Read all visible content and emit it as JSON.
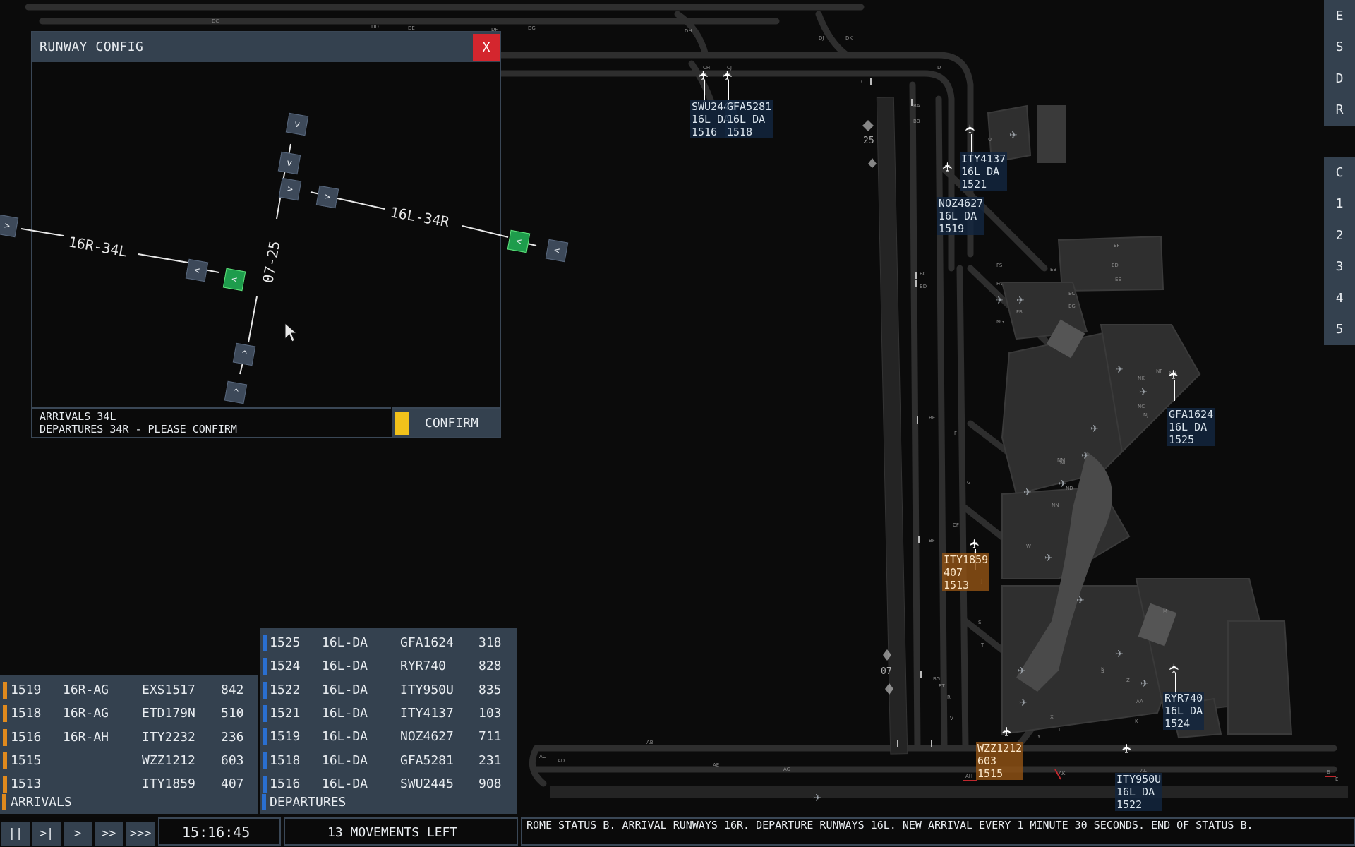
{
  "side_menu_top": [
    "E",
    "S",
    "D",
    "R"
  ],
  "side_menu_bottom": [
    "C",
    "1",
    "2",
    "3",
    "4",
    "5"
  ],
  "runway_config": {
    "title": "RUNWAY CONFIG",
    "close_label": "X",
    "runway_labels": {
      "left": "16R-34L",
      "right": "16L-34R",
      "cross": "07-25"
    },
    "message_line1": "ARRIVALS 34L",
    "message_line2": "DEPARTURES 34R - PLEASE CONFIRM",
    "confirm_label": "CONFIRM",
    "buttons": {
      "down": "v",
      "right": ">",
      "left": "<",
      "up": "^"
    }
  },
  "map_labels": {
    "runway_25": "25",
    "runway_07": "07",
    "taxiways": [
      "DC",
      "DD",
      "DE",
      "DF",
      "DG",
      "DH",
      "DJ",
      "DK",
      "CH",
      "CJ",
      "C",
      "D",
      "BA",
      "BB",
      "U",
      "FS",
      "FA",
      "FB",
      "EB",
      "EC",
      "ED",
      "EE",
      "EF",
      "EG",
      "NG",
      "BC",
      "BD",
      "NF",
      "NK",
      "NH",
      "NC",
      "NJ",
      "NM",
      "NL",
      "NN",
      "ND",
      "BE",
      "F",
      "G",
      "CF",
      "BF",
      "H",
      "J",
      "S",
      "T",
      "BG",
      "RT",
      "R",
      "V",
      "W",
      "X",
      "Y",
      "Z",
      "K",
      "L",
      "A",
      "AA",
      "AB",
      "AC",
      "AD",
      "AE",
      "AG",
      "AH",
      "AK",
      "AL",
      "B",
      "E",
      "M",
      "N"
    ]
  },
  "flight_tags": [
    {
      "callsign": "SWU2445",
      "line2": "16L DA",
      "line3": "1516",
      "style": "blue"
    },
    {
      "callsign": "GFA5281",
      "line2": "16L DA",
      "line3": "1518",
      "style": "blue"
    },
    {
      "callsign": "ITY4137",
      "line2": "16L DA",
      "line3": "1521",
      "style": "blue"
    },
    {
      "callsign": "NOZ4627",
      "line2": "16L DA",
      "line3": "1519",
      "style": "blue"
    },
    {
      "callsign": "GFA1624",
      "line2": "16L DA",
      "line3": "1525",
      "style": "blue"
    },
    {
      "callsign": "ITY1859",
      "line2": "407",
      "line3": "1513",
      "style": "orange"
    },
    {
      "callsign": "RYR740",
      "line2": "16L DA",
      "line3": "1524",
      "style": "blue"
    },
    {
      "callsign": "WZZ1212",
      "line2": "603",
      "line3": "1515",
      "style": "orange"
    },
    {
      "callsign": "ITY950U",
      "line2": "16L DA",
      "line3": "1522",
      "style": "blue"
    }
  ],
  "arrivals": {
    "label": "ARRIVALS",
    "rows": [
      {
        "time": "1519",
        "rwy": "16R-AG",
        "callsign": "EXS1517",
        "num": "842"
      },
      {
        "time": "1518",
        "rwy": "16R-AG",
        "callsign": "ETD179N",
        "num": "510"
      },
      {
        "time": "1516",
        "rwy": "16R-AH",
        "callsign": "ITY2232",
        "num": "236"
      },
      {
        "time": "1515",
        "rwy": "",
        "callsign": "WZZ1212",
        "num": "603"
      },
      {
        "time": "1513",
        "rwy": "",
        "callsign": "ITY1859",
        "num": "407"
      }
    ],
    "bar_color": "#e08a1e"
  },
  "departures": {
    "label": "DEPARTURES",
    "rows": [
      {
        "time": "1525",
        "rwy": "16L-DA",
        "callsign": "GFA1624",
        "num": "318"
      },
      {
        "time": "1524",
        "rwy": "16L-DA",
        "callsign": "RYR740",
        "num": "828"
      },
      {
        "time": "1522",
        "rwy": "16L-DA",
        "callsign": "ITY950U",
        "num": "835"
      },
      {
        "time": "1521",
        "rwy": "16L-DA",
        "callsign": "ITY4137",
        "num": "103"
      },
      {
        "time": "1519",
        "rwy": "16L-DA",
        "callsign": "NOZ4627",
        "num": "711"
      },
      {
        "time": "1518",
        "rwy": "16L-DA",
        "callsign": "GFA5281",
        "num": "231"
      },
      {
        "time": "1516",
        "rwy": "16L-DA",
        "callsign": "SWU2445",
        "num": "908"
      }
    ],
    "bar_color": "#2a6fd0"
  },
  "speed_controls": [
    "||",
    ">|",
    ">",
    ">>",
    ">>>"
  ],
  "clock": "15:16:45",
  "movements_left": "13 MOVEMENTS LEFT",
  "status_message": "ROME STATUS B. ARRIVAL RUNWAYS 16R. DEPARTURE RUNWAYS 16L. NEW ARRIVAL EVERY 1 MINUTE 30 SECONDS. END OF STATUS B.",
  "colors": {
    "panel": "#34414f",
    "accent_green": "#1e9c4c",
    "accent_yellow": "#f2c21b",
    "close_red": "#d4262e"
  }
}
